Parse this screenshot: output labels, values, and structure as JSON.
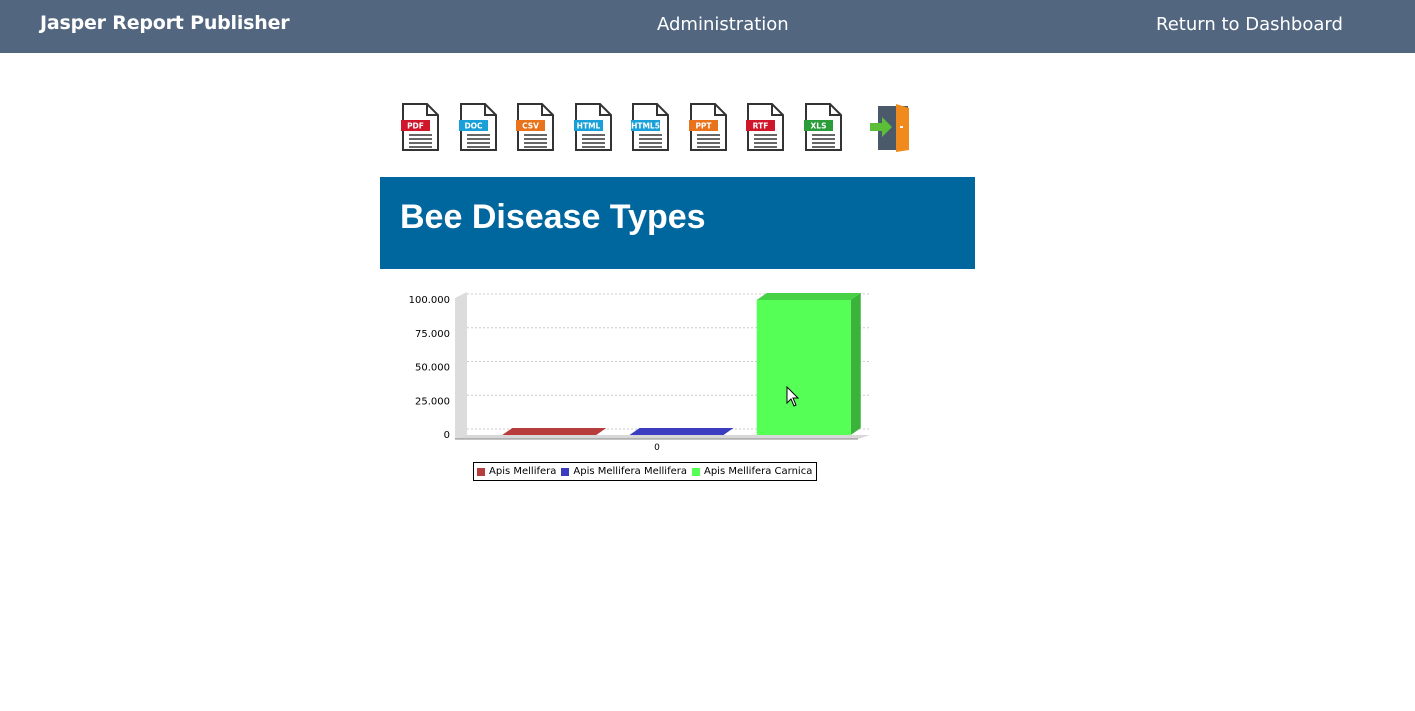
{
  "header": {
    "brand": "Jasper Report Publisher",
    "nav": [
      "Administration",
      "Return to Dashboard"
    ]
  },
  "export_formats": [
    {
      "label": "PDF",
      "color": "#d0162b",
      "icon": "pdf-file-icon"
    },
    {
      "label": "DOC",
      "color": "#1aa0d8",
      "icon": "doc-file-icon"
    },
    {
      "label": "CSV",
      "color": "#e8731c",
      "icon": "csv-file-icon"
    },
    {
      "label": "HTML",
      "color": "#1aa0d8",
      "icon": "html-file-icon"
    },
    {
      "label": "HTML5",
      "color": "#1aa0d8",
      "icon": "html5-file-icon"
    },
    {
      "label": "PPT",
      "color": "#e8731c",
      "icon": "ppt-file-icon"
    },
    {
      "label": "RTF",
      "color": "#d0162b",
      "icon": "rtf-file-icon"
    },
    {
      "label": "XLS",
      "color": "#2a9d3a",
      "icon": "xls-file-icon"
    }
  ],
  "exit_icon": "exit-door-icon",
  "report": {
    "title": "Bee Disease Types"
  },
  "chart_data": {
    "type": "bar",
    "categories": [
      "0"
    ],
    "series": [
      {
        "name": "Apis Mellifera",
        "values": [
          0
        ],
        "color": "#b83c3c"
      },
      {
        "name": "Apis Mellifera Mellifera",
        "values": [
          0
        ],
        "color": "#3c3cc0"
      },
      {
        "name": "Apis Mellifera Carnica",
        "values": [
          100
        ],
        "color": "#55ff55"
      }
    ],
    "y_ticks": [
      "0",
      "25.000",
      "50.000",
      "75.000",
      "100.000"
    ],
    "ylim": [
      0,
      100
    ],
    "grid": true,
    "legend_position": "bottom",
    "style": "3d"
  }
}
